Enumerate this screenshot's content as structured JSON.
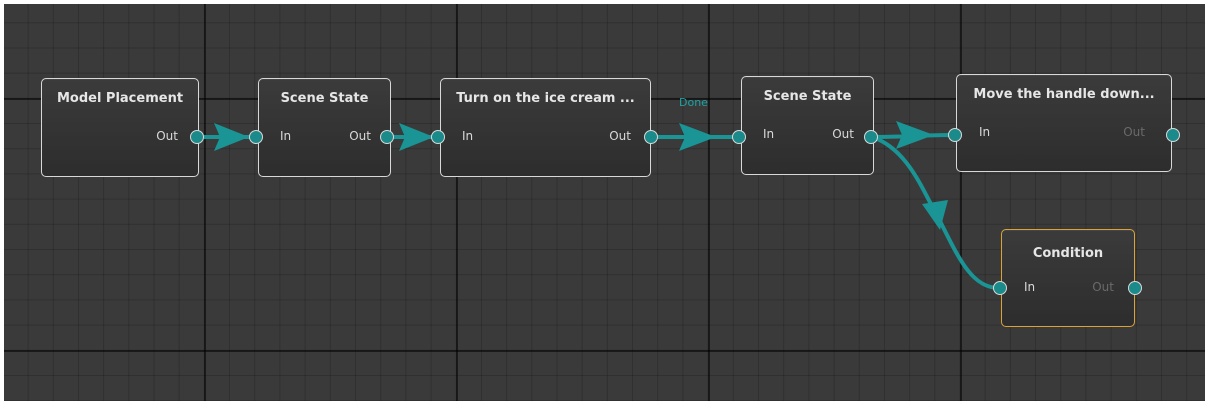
{
  "graph": {
    "nodes": [
      {
        "id": "model-placement",
        "title": "Model Placement",
        "inputs": [],
        "outputs": [
          "Out"
        ]
      },
      {
        "id": "scene-state-1",
        "title": "Scene State",
        "inputs": [
          "In"
        ],
        "outputs": [
          "Out"
        ]
      },
      {
        "id": "ice-cream",
        "title": "Turn on the ice cream ...",
        "inputs": [
          "In"
        ],
        "outputs": [
          "Out"
        ]
      },
      {
        "id": "scene-state-2",
        "title": "Scene State",
        "inputs": [
          "In"
        ],
        "outputs": [
          "Out"
        ]
      },
      {
        "id": "move-handle",
        "title": "Move the handle down...",
        "inputs": [
          "In"
        ],
        "outputs": [
          "Out"
        ]
      },
      {
        "id": "condition",
        "title": "Condition",
        "inputs": [
          "In"
        ],
        "outputs": [
          "Out"
        ],
        "selected": true
      }
    ],
    "edges": [
      {
        "from": "model-placement",
        "to": "scene-state-1"
      },
      {
        "from": "scene-state-1",
        "to": "ice-cream"
      },
      {
        "from": "ice-cream",
        "to": "scene-state-2",
        "label": "Done"
      },
      {
        "from": "scene-state-2",
        "to": "move-handle"
      },
      {
        "from": "scene-state-2",
        "to": "condition"
      }
    ]
  },
  "colors": {
    "canvas": "#3a3a3a",
    "wire": "#1a9494",
    "port": "#1b8a8a",
    "node_border": "#d8d8d8",
    "selected_border": "#d9a338",
    "edge_label": "#1ea3a3"
  }
}
